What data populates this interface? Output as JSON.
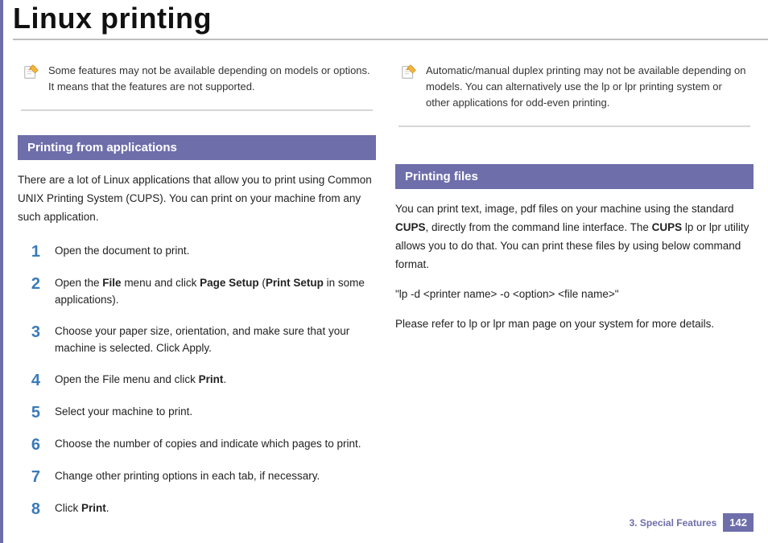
{
  "title": "Linux printing",
  "left": {
    "note": "Some features may not be available depending on models or options. It means that the features are not supported.",
    "section_title": "Printing from applications",
    "intro": "There are a lot of Linux applications that allow you to print using Common UNIX Printing System (CUPS). You can print on your machine from any such application.",
    "steps": [
      {
        "num": "1",
        "html": "Open the document to print."
      },
      {
        "num": "2",
        "html": "Open the <b>File</b> menu and click <b>Page Setup</b> (<b>Print Setup</b> in some applications)."
      },
      {
        "num": "3",
        "html": "Choose your paper size, orientation, and make sure that your machine is selected. Click Apply."
      },
      {
        "num": "4",
        "html": "Open the File menu and click <b>Print</b>."
      },
      {
        "num": "5",
        "html": "Select your machine to print."
      },
      {
        "num": "6",
        "html": "Choose the number of copies and indicate which pages to print."
      },
      {
        "num": "7",
        "html": "Change other printing options in each tab, if necessary."
      },
      {
        "num": "8",
        "html": "Click <b>Print</b>."
      }
    ]
  },
  "right": {
    "note": "Automatic/manual duplex printing may not be available depending on models. You can alternatively use the lp or lpr printing system or other applications for odd-even printing.",
    "section_title": "Printing files",
    "p1": "You can print text, image, pdf files on your machine using the standard <b>CUPS</b>, directly from the command line interface. The <b>CUPS</b> lp or lpr utility allows you to do that. You can print these files by using below command format.",
    "p2": "\"lp -d <printer name> -o <option> <file name>\"",
    "p3": "Please refer to lp or lpr man page on your system for more details."
  },
  "footer": {
    "section": "3.  Special Features",
    "page": "142"
  }
}
